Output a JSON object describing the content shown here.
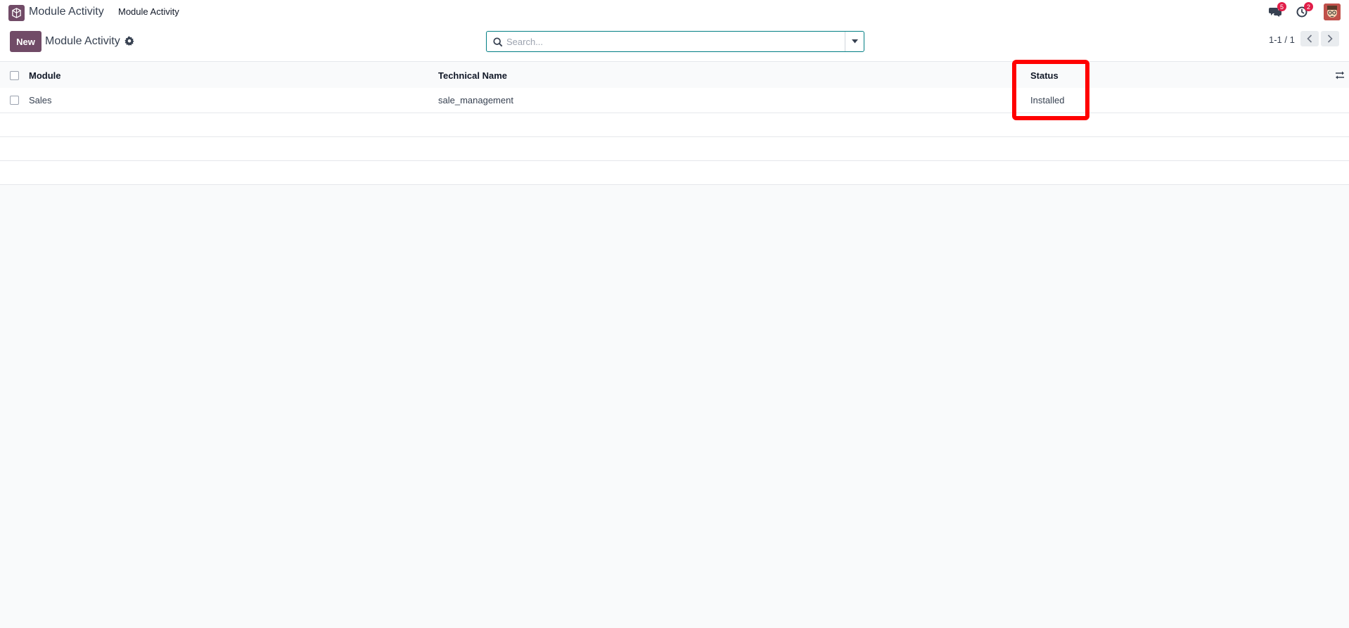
{
  "navbar": {
    "app_name": "Module Activity",
    "menu_item": "Module Activity",
    "messages_badge": "5",
    "activities_badge": "2"
  },
  "control_panel": {
    "new_label": "New",
    "title": "Module Activity",
    "search": {
      "placeholder": "Search...",
      "value": ""
    },
    "pager": "1-1 / 1"
  },
  "list": {
    "columns": [
      "Module",
      "Technical Name",
      "Status"
    ],
    "rows": [
      {
        "module": "Sales",
        "technical_name": "sale_management",
        "status": "Installed"
      }
    ]
  },
  "colors": {
    "brand": "#714b67",
    "accent": "#017e84",
    "highlight": "#ff0000"
  },
  "icons": [
    "app-logo-icon",
    "gear-icon",
    "search-icon",
    "caret-down-icon",
    "chevron-left-icon",
    "chevron-right-icon",
    "chat-icon",
    "clock-icon",
    "optional-columns-icon"
  ]
}
